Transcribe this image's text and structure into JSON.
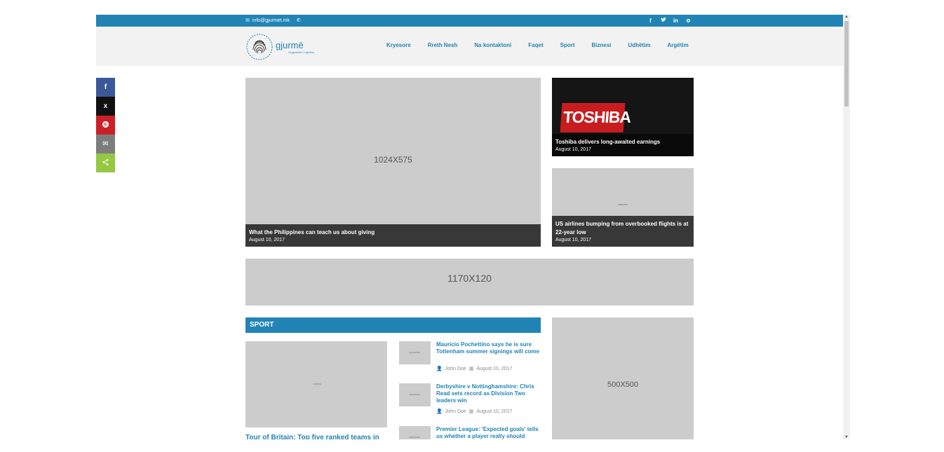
{
  "topbar": {
    "email": "info@gjurmet.mk",
    "social": [
      "f",
      "t",
      "in",
      "p"
    ]
  },
  "logo": {
    "brand": "gjurmë",
    "tagline": "Organizimi i Lajmeve"
  },
  "nav": [
    "Kryesore",
    "Rreth Nesh",
    "Na kontaktoni",
    "Faqet",
    "Sport",
    "Biznesi",
    "Udhëtim",
    "Argëtim"
  ],
  "featured": {
    "main": {
      "dim": "1024X575",
      "title": "What the Philippines can teach us about giving",
      "date": "August 10, 2017"
    },
    "side1": {
      "banner": "TOSHIBA",
      "title": "Toshiba delivers long-awaited earnings",
      "date": "August 10, 2017"
    },
    "side2": {
      "dim": "1024X575",
      "title": "US airlines bumping from overbooked flights is at 22-year low",
      "date": "August 10, 2017"
    }
  },
  "ad_banner": "1170X120",
  "sport": {
    "heading": "SPORT",
    "lead_title": "Tour of Britain: Top five ranked teams in",
    "items": [
      {
        "title": "Mauricio Pochettino says he is sure Tottenham summer signings will come",
        "author": "John Doe",
        "date": "August 10, 2017"
      },
      {
        "title": "Derbyshire v Nottinghamshire: Chris Read sets record as Division Two leaders win",
        "author": "John Doe",
        "date": "August 10, 2017"
      },
      {
        "title": "Premier League: 'Expected goals' tells us whether a player really should",
        "author": "",
        "date": ""
      }
    ]
  },
  "side_ad": "500X500",
  "share_bar": [
    "f",
    "x",
    "p",
    "email",
    "share"
  ],
  "colors": {
    "accent": "#2184b5",
    "facebook": "#3b5998",
    "x": "#111111",
    "pinterest": "#cb2027",
    "email": "#7d7d7d",
    "share": "#95c842"
  }
}
